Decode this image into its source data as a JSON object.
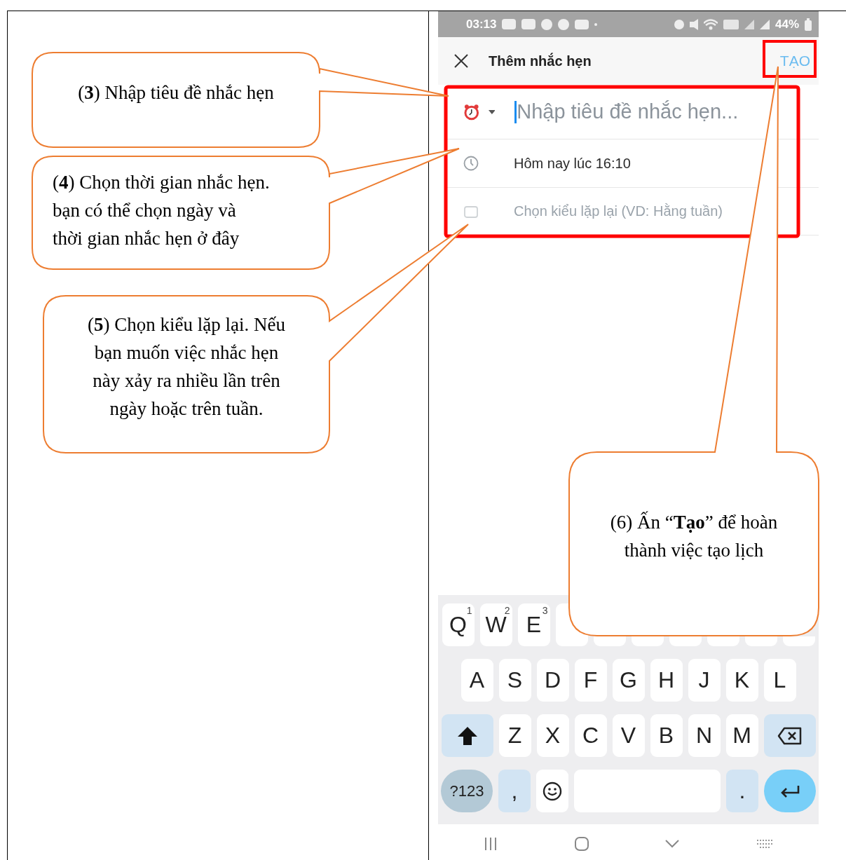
{
  "status_bar": {
    "time": "03:13",
    "battery": "44%"
  },
  "header": {
    "title": "Thêm nhắc hẹn",
    "action": "TẠO"
  },
  "form": {
    "title_field": {
      "placeholder": "Nhập tiêu đề nhắc hẹn..."
    },
    "rows": [
      {
        "kind": "time",
        "text": "Hôm nay lúc 16:10"
      },
      {
        "kind": "repeat",
        "text": "Chọn kiểu lặp lại (VD: Hằng tuần)"
      }
    ]
  },
  "keyboard": {
    "rows": [
      {
        "keys": [
          {
            "kind": "letter",
            "label": "Q",
            "hint": "1"
          },
          {
            "kind": "letter",
            "label": "W",
            "hint": "2"
          },
          {
            "kind": "letter",
            "label": "E",
            "hint": "3"
          }
        ]
      },
      {
        "keys": [
          {
            "kind": "letter",
            "label": "A"
          },
          {
            "kind": "letter",
            "label": "S"
          },
          {
            "kind": "letter",
            "label": "D"
          },
          {
            "kind": "letter",
            "label": "F"
          },
          {
            "kind": "letter",
            "label": "G"
          },
          {
            "kind": "letter",
            "label": "H"
          },
          {
            "kind": "letter",
            "label": "J"
          },
          {
            "kind": "letter",
            "label": "K"
          },
          {
            "kind": "letter",
            "label": "L"
          }
        ]
      },
      {
        "keys": [
          {
            "kind": "shift"
          },
          {
            "kind": "letter",
            "label": "Z"
          },
          {
            "kind": "letter",
            "label": "X"
          },
          {
            "kind": "letter",
            "label": "C"
          },
          {
            "kind": "letter",
            "label": "V"
          },
          {
            "kind": "letter",
            "label": "B"
          },
          {
            "kind": "letter",
            "label": "N"
          },
          {
            "kind": "letter",
            "label": "M"
          },
          {
            "kind": "backspace"
          }
        ]
      },
      {
        "keys": [
          {
            "kind": "symbols",
            "label": "?123"
          },
          {
            "kind": "punct",
            "label": ","
          },
          {
            "kind": "emoji"
          },
          {
            "kind": "space"
          },
          {
            "kind": "punct",
            "label": "."
          },
          {
            "kind": "enter"
          }
        ]
      }
    ]
  },
  "callouts": [
    {
      "lines": [
        "(**3**) Nhập tiêu đề nhắc hẹn"
      ]
    },
    {
      "lines": [
        "(**4**) Chọn thời gian nhắc hẹn.",
        "bạn có thể chọn ngày và",
        "thời gian nhắc hẹn ở đây"
      ]
    },
    {
      "lines": [
        "(**5**) Chọn kiểu lặp lại. Nếu",
        "bạn muốn việc nhắc hẹn",
        "này xảy ra nhiều lần trên",
        "ngày hoặc trên tuần."
      ]
    },
    {
      "lines": [
        "(6) Ấn “**Tạo**” để hoàn",
        "thành việc tạo lịch"
      ]
    }
  ]
}
